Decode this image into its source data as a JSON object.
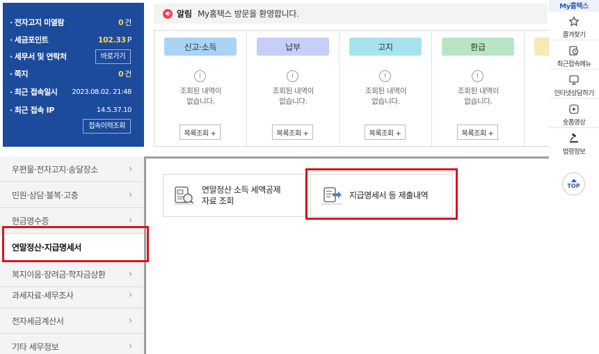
{
  "info_box": {
    "rows": [
      {
        "label": "전자고지 미열람",
        "value": "0",
        "unit": "건"
      },
      {
        "label": "세금포인트",
        "value": "102.33",
        "unit": "P"
      },
      {
        "label": "세무서 및 연락처",
        "button": "바로가기"
      },
      {
        "label": "쪽지",
        "value": "0",
        "unit": "건"
      },
      {
        "label": "최근 접속일시",
        "value": "2023.08.02.  21:48"
      },
      {
        "label": "최근 접속 IP",
        "value": "14.5.37.10",
        "button": "접속이력조회"
      }
    ]
  },
  "notice": {
    "label": "알림",
    "text": "My홈택스 방문을 환영합니다."
  },
  "categories": [
    {
      "title": "신고·소득",
      "color": "#a8d3f5",
      "empty": "조회된 내역이\n없습니다.",
      "button": "목록조회 +"
    },
    {
      "title": "납부",
      "color": "#c5cff8",
      "empty": "조회된 내역이\n없습니다.",
      "button": "목록조회 +"
    },
    {
      "title": "고지",
      "color": "#a7e3ef",
      "empty": "조회된 내역이\n없습니다.",
      "button": "목록조회 +"
    },
    {
      "title": "환급",
      "color": "#b8e6c4",
      "empty": "조회된 내역이\n없습니다.",
      "button": "목록조회 +"
    },
    {
      "title": "",
      "color": "#f6e9b5",
      "empty": "",
      "button": ""
    }
  ],
  "sidebar": {
    "items": [
      {
        "label": "우편물·전자고지·송달장소",
        "active": false
      },
      {
        "label": "민원·상담·불복·고충",
        "active": false
      },
      {
        "label": "현금영수증",
        "active": false
      },
      {
        "label": "연말정산·지급명세서",
        "active": true
      },
      {
        "label": "복지이음·장려금·학자금상환",
        "active": false
      },
      {
        "label": "과세자료·세무조사",
        "active": false
      },
      {
        "label": "전자세금계산서",
        "active": false
      },
      {
        "label": "기타 세무정보",
        "active": false
      }
    ]
  },
  "services": [
    {
      "label_line1": "연말정산 소득 세액공제",
      "label_line2": "자료 조회",
      "icon": "document-search-icon"
    },
    {
      "label_line1": "지급명세서 등 제출내역",
      "label_line2": "",
      "icon": "document-submit-icon"
    }
  ],
  "quick_menu": {
    "title": "My홈택스",
    "items": [
      {
        "label": "즐겨찾기",
        "icon": "star-icon"
      },
      {
        "label": "최근접속메뉴",
        "icon": "recent-menu-icon"
      },
      {
        "label": "인터넷상담하기",
        "icon": "monitor-icon"
      },
      {
        "label": "숏폼영상",
        "icon": "play-icon"
      },
      {
        "label": "법령정보",
        "icon": "gavel-icon"
      }
    ],
    "top_label": "TOP"
  }
}
